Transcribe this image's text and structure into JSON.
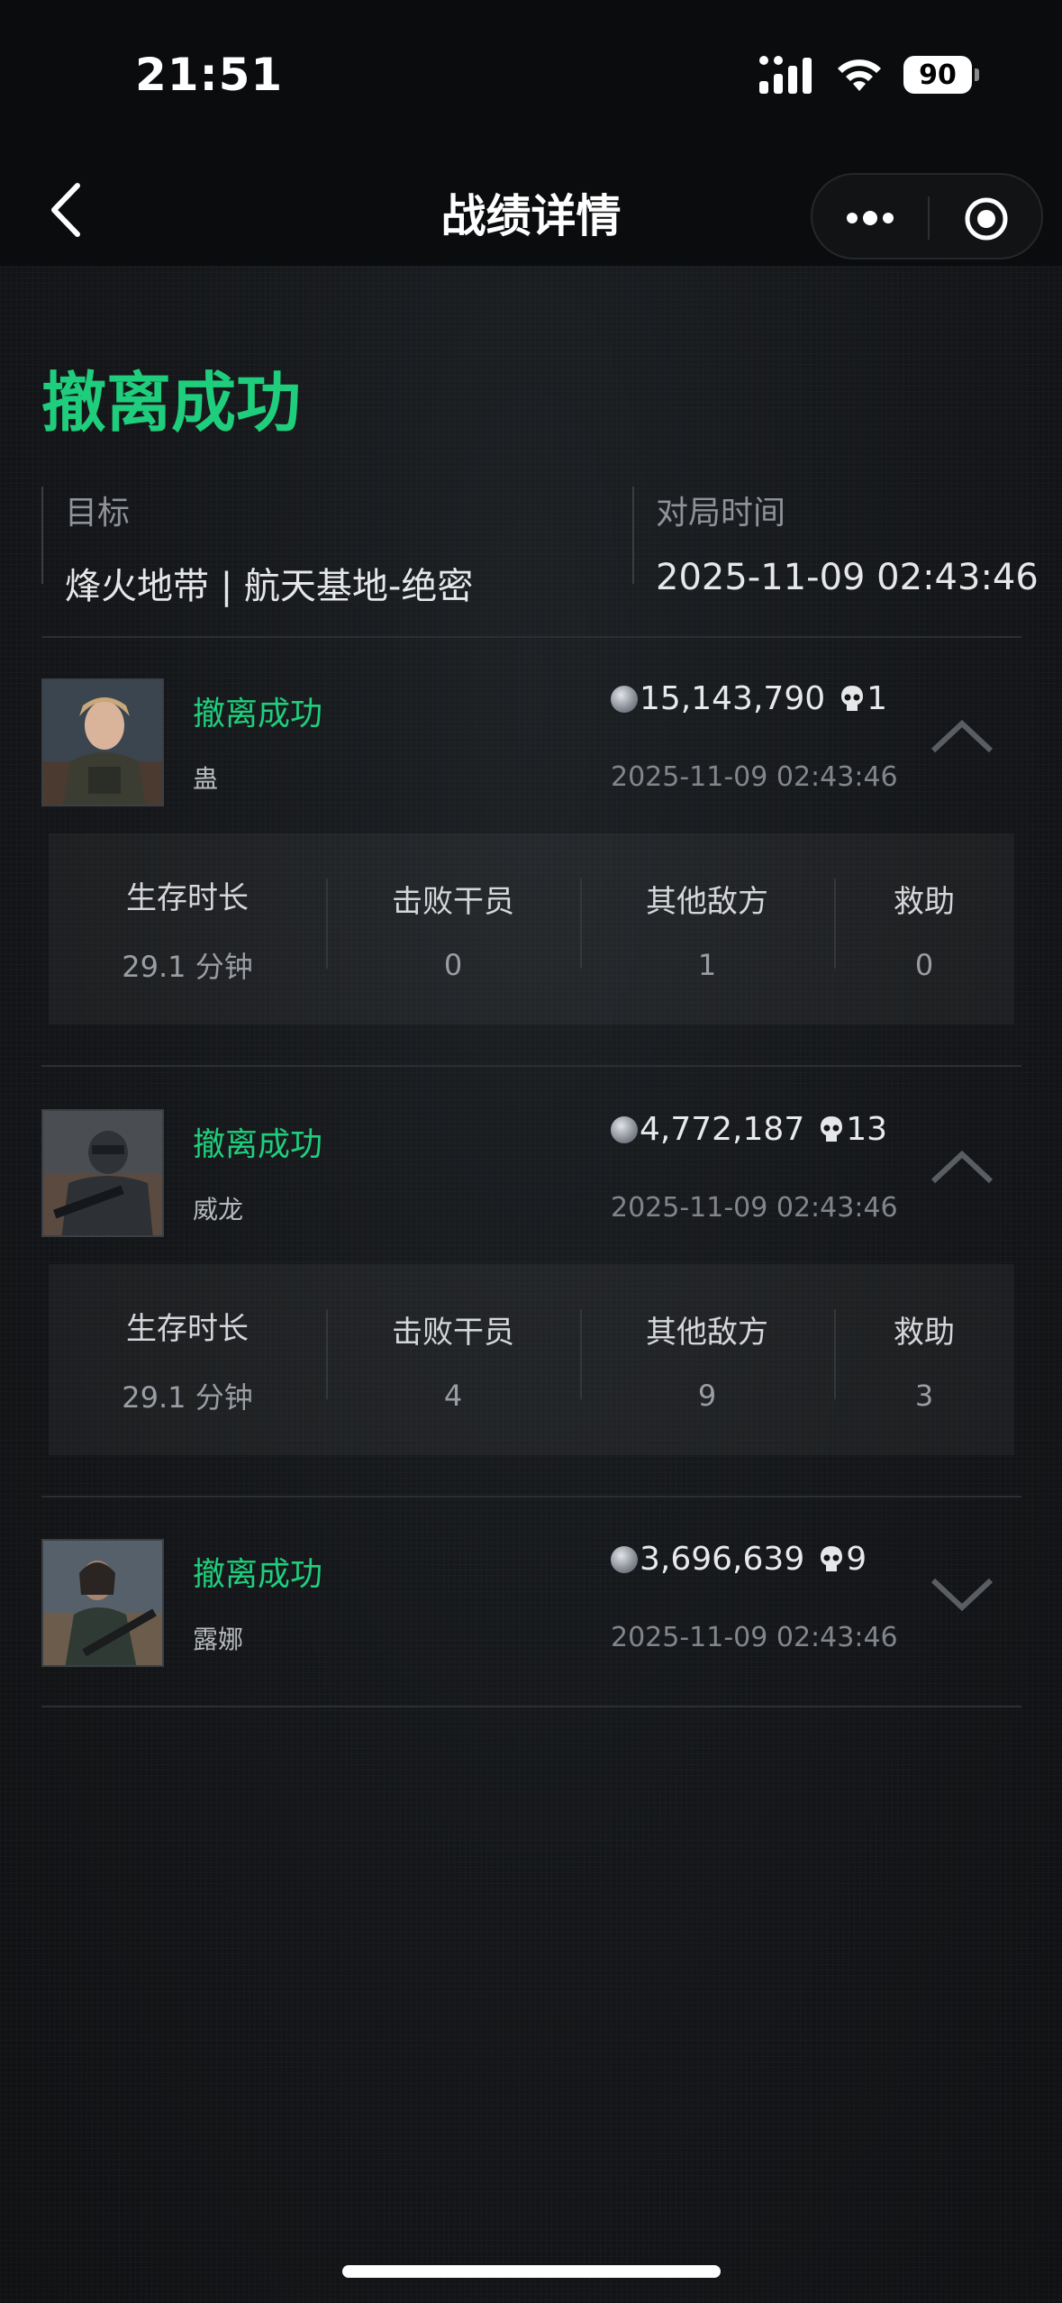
{
  "status_bar": {
    "time": "21:51",
    "battery": "90",
    "icons": [
      "signal-icon",
      "wifi-icon",
      "battery-icon"
    ]
  },
  "nav": {
    "title": "战绩详情",
    "back_icon": "chevron-left-icon",
    "more_icon": "more-dots-icon",
    "close_icon": "target-circle-icon"
  },
  "summary": {
    "result": "撤离成功",
    "target_label": "目标",
    "target_value": "烽火地带 | 航天基地-绝密",
    "time_label": "对局时间",
    "time_value": "2025-11-09 02:43:46"
  },
  "stat_labels": {
    "survival": "生存时长",
    "kills": "击败干员",
    "others": "其他敌方",
    "assist": "救助"
  },
  "players": [
    {
      "status": "撤离成功",
      "name": "蛊",
      "value": "15,143,790",
      "kills": "1",
      "time": "2025-11-09 02:43:46",
      "expanded": true,
      "stats": {
        "survival": "29.1 分钟",
        "kills": "0",
        "others": "1",
        "assist": "0"
      }
    },
    {
      "status": "撤离成功",
      "name": "威龙",
      "value": "4,772,187",
      "kills": "13",
      "time": "2025-11-09 02:43:46",
      "expanded": true,
      "stats": {
        "survival": "29.1 分钟",
        "kills": "4",
        "others": "9",
        "assist": "3"
      }
    },
    {
      "status": "撤离成功",
      "name": "露娜",
      "value": "3,696,639",
      "kills": "9",
      "time": "2025-11-09 02:43:46",
      "expanded": false
    }
  ],
  "colors": {
    "accent": "#1fce7c",
    "background": "#121416"
  }
}
